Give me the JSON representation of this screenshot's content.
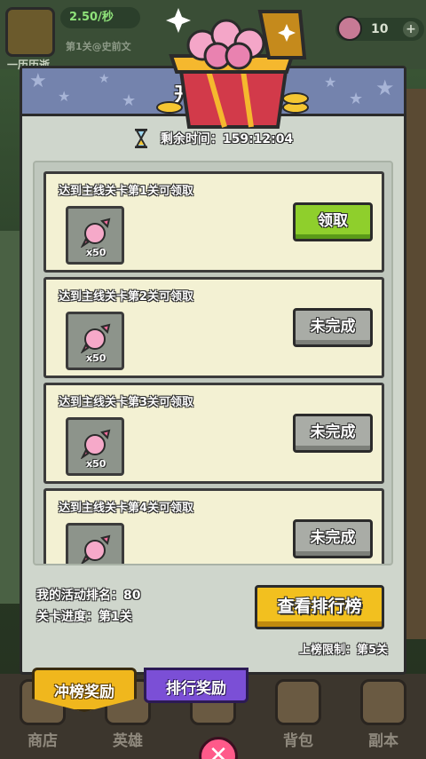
{
  "hud": {
    "rate": "2.50/秒",
    "stage": "第1关@史前文",
    "player_name": "一历历逝",
    "gem_count": "10"
  },
  "nav": [
    "商店",
    "英雄",
    "",
    "背包",
    "副本"
  ],
  "tabs": {
    "rush_rewards": "冲榜奖励",
    "rank_rewards": "排行奖励"
  },
  "dialog": {
    "title": "开服冲榜",
    "timer_label": "剩余时间：159:12:04",
    "tasks": [
      {
        "desc": "达到主线关卡第1关可领取",
        "qty": "x50",
        "button": "领取",
        "state": "claim"
      },
      {
        "desc": "达到主线关卡第2关可领取",
        "qty": "x50",
        "button": "未完成",
        "state": "pending"
      },
      {
        "desc": "达到主线关卡第3关可领取",
        "qty": "x50",
        "button": "未完成",
        "state": "pending"
      },
      {
        "desc": "达到主线关卡第4关可领取",
        "qty": "",
        "button": "未完成",
        "state": "pending"
      }
    ],
    "my_rank": "我的活动排名：80",
    "progress": "关卡进度：第1关",
    "view_rank_button": "查看排行榜",
    "rank_limit": "上榜限制：第5关"
  },
  "colors": {
    "claim": "#8fcf2c",
    "pending": "#a9aca6",
    "header": "#7483ad",
    "rank_button": "#f2c01f"
  }
}
